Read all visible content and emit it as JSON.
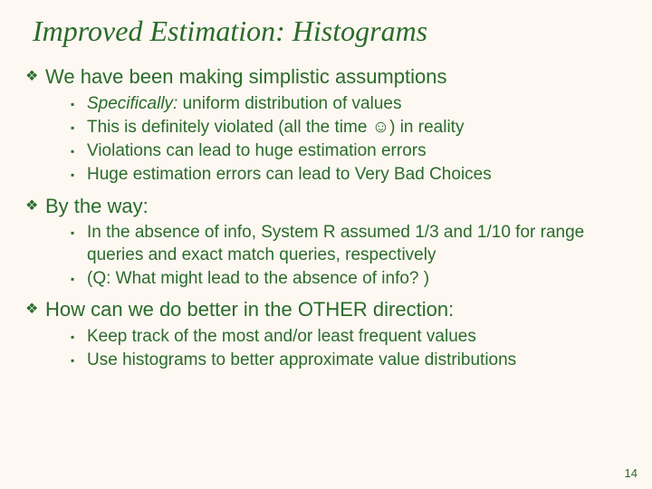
{
  "title": "Improved Estimation: Histograms",
  "diamond": "❖",
  "square": "▪",
  "sections": [
    {
      "heading": "We have been making simplistic assumptions",
      "items": [
        {
          "prefix": "Specifically:",
          "rest": "  uniform distribution of values"
        },
        {
          "text": "This is definitely violated (all the time ☺) in reality"
        },
        {
          "text": "Violations can lead to huge estimation errors"
        },
        {
          "text": "Huge estimation errors can lead to Very Bad Choices"
        }
      ]
    },
    {
      "heading": "By the way:",
      "items": [
        {
          "text": "In the absence of info, System R assumed 1/3 and 1/10 for range queries and exact match queries, respectively"
        },
        {
          "text": "(Q:  What might lead to the absence of info? )"
        }
      ]
    },
    {
      "heading": "How can we do better in the OTHER direction:",
      "items": [
        {
          "text": "Keep track of the most and/or least frequent values"
        },
        {
          "text": "Use histograms to better approximate value distributions"
        }
      ]
    }
  ],
  "page_number": "14"
}
